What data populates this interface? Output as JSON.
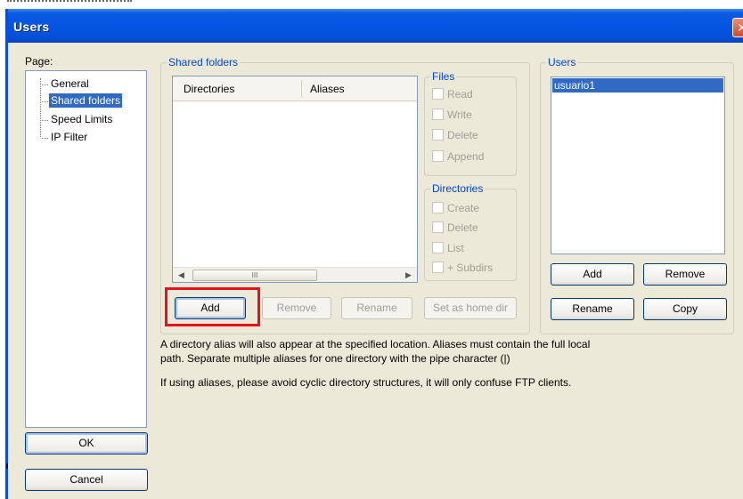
{
  "window": {
    "title": "Users",
    "close_icon": "close-icon"
  },
  "page_panel": {
    "label": "Page:",
    "items": [
      {
        "label": "General",
        "selected": false
      },
      {
        "label": "Shared folders",
        "selected": true
      },
      {
        "label": "Speed Limits",
        "selected": false
      },
      {
        "label": "IP Filter",
        "selected": false
      }
    ]
  },
  "shared_folders": {
    "title": "Shared folders",
    "columns": [
      "Directories",
      "Aliases"
    ],
    "scroll_grip": "III",
    "buttons": {
      "add": "Add",
      "remove": "Remove",
      "rename": "Rename",
      "home": "Set as home dir"
    }
  },
  "files": {
    "title": "Files",
    "options": [
      "Read",
      "Write",
      "Delete",
      "Append"
    ]
  },
  "directories": {
    "title": "Directories",
    "options": [
      "Create",
      "Delete",
      "List",
      "+ Subdirs"
    ]
  },
  "users": {
    "title": "Users",
    "list": [
      "usuario1"
    ],
    "buttons": {
      "add": "Add",
      "remove": "Remove",
      "rename": "Rename",
      "copy": "Copy"
    }
  },
  "description": {
    "line1": "A directory alias will also appear at the specified location. Aliases must contain the full local",
    "line2": "path. Separate multiple aliases for one directory with the pipe character (|)",
    "line3": "If using aliases, please avoid cyclic directory structures, it will only confuse FTP clients."
  },
  "footer": {
    "ok": "OK",
    "cancel": "Cancel"
  },
  "colors": {
    "titlebar": "#0654e4",
    "dialog_bg": "#ece9d8",
    "selection": "#316ac5",
    "highlight": "#e8101a"
  }
}
